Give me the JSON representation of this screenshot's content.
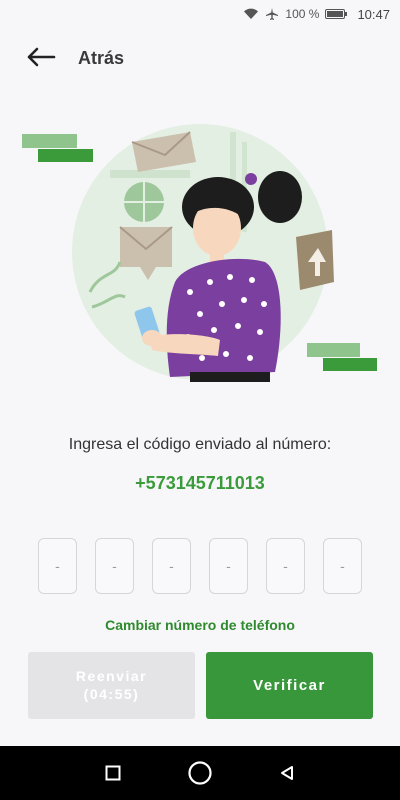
{
  "status_bar": {
    "battery_percent": "100 %",
    "time": "10:47",
    "icons": [
      "wifi-icon",
      "airplane-icon",
      "battery-icon"
    ]
  },
  "header": {
    "back_label": "Atrás"
  },
  "verification": {
    "prompt": "Ingresa el código enviado al número:",
    "phone_number": "+573145711013",
    "code_placeholders": [
      "-",
      "-",
      "-",
      "-",
      "-",
      "-"
    ],
    "change_number_link": "Cambiar número de teléfono",
    "resend_label": "Reenviar\n(04:55)",
    "verify_label": "Verificar"
  },
  "colors": {
    "accent": "#37973a",
    "accent_text": "#3b9b3a",
    "disabled_button": "#e4e4e6",
    "background": "#f7f7fa"
  },
  "nav_bar": {
    "icons": [
      "recents-square-icon",
      "home-circle-icon",
      "back-triangle-icon"
    ]
  }
}
